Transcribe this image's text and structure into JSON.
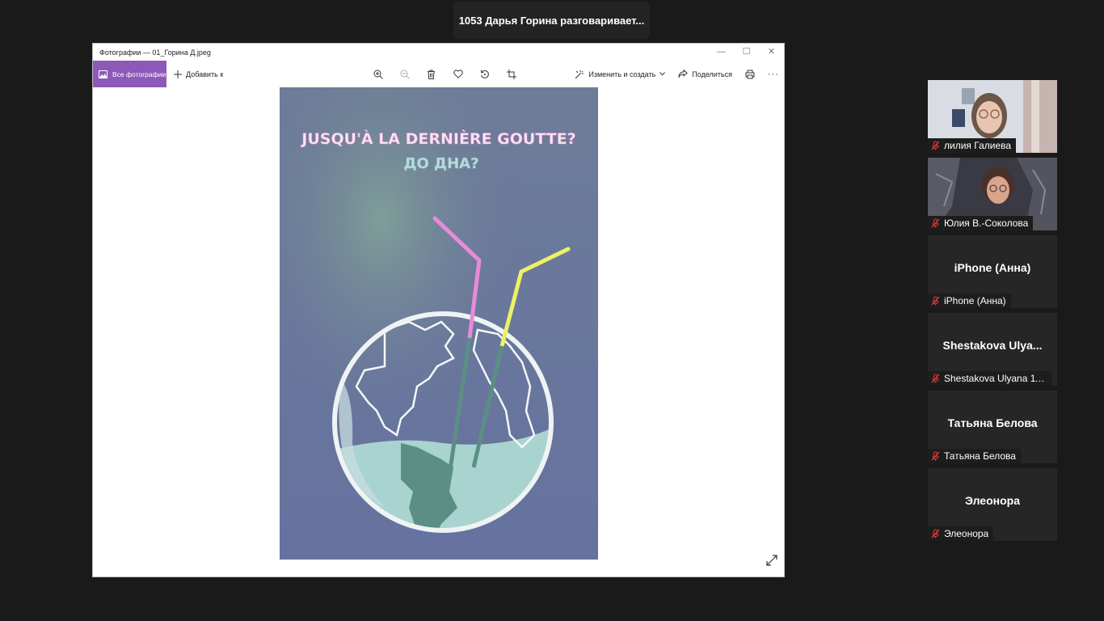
{
  "speaker": "1053 Дарья Горина разговаривает...",
  "window": {
    "title": "Фотографии — 01_Горина Д.jpeg",
    "controls": {
      "minimize": "—",
      "maximize": "☐",
      "close": "✕"
    }
  },
  "toolbar": {
    "all_photos": "Все фотографии",
    "add_to": "Добавить к",
    "edit_create": "Изменить и создать",
    "share": "Поделиться",
    "more": "···"
  },
  "poster": {
    "title_fr": "JUSQU'À LA DERNIÈRE GOUTTE?",
    "title_ru": "ДО ДНА?",
    "colors": {
      "bg": "#6b7597",
      "title": "#fce4f2",
      "subtitle": "#b7ddd8",
      "water": "#a9d3cf",
      "land": "#5b8f84",
      "pink": "#e98ad9",
      "yellow": "#eef066"
    }
  },
  "participants": [
    {
      "name": "лилия Галиева",
      "video": "girl"
    },
    {
      "name": "Юлия В.-Соколова",
      "video": "woman"
    },
    {
      "name": "iPhone (Анна)",
      "display": "iPhone (Анна)"
    },
    {
      "name": "Shestakova Ulyana 11...",
      "display": "Shestakova Ulya..."
    },
    {
      "name": "Татьяна Белова",
      "display": "Татьяна Белова"
    },
    {
      "name": "Элеонора",
      "display": "Элеонора"
    }
  ]
}
